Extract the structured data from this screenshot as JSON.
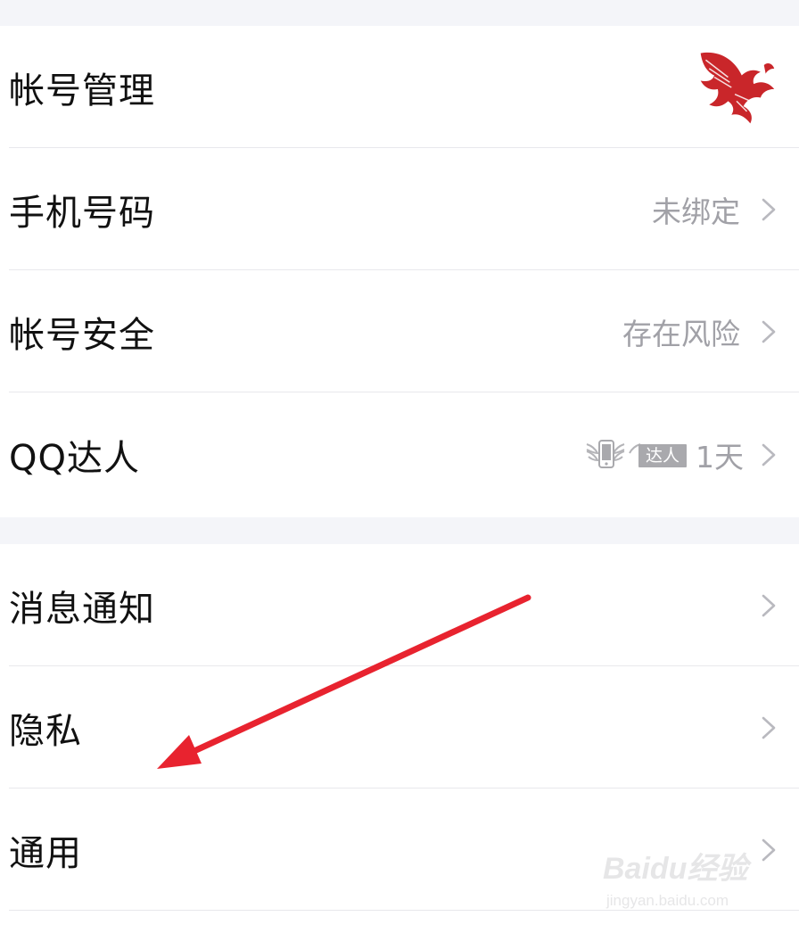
{
  "group1": [
    {
      "label": "帐号管理",
      "value": "",
      "trailing": "avatar"
    },
    {
      "label": "手机号码",
      "value": "未绑定",
      "trailing": "chevron"
    },
    {
      "label": "帐号安全",
      "value": "存在风险",
      "trailing": "chevron"
    },
    {
      "label": "QQ达人",
      "value": "1天",
      "trailing": "badge",
      "badge_text": "达人"
    }
  ],
  "group2": [
    {
      "label": "消息通知",
      "trailing": "chevron"
    },
    {
      "label": "隐私",
      "trailing": "chevron"
    },
    {
      "label": "通用",
      "trailing": "chevron"
    }
  ],
  "avatar_icon": "eagle-avatar-icon",
  "colors": {
    "background": "#f4f5f9",
    "row": "#ffffff",
    "text": "#111111",
    "secondary": "#a1a1a7",
    "annotation_arrow": "#e8232f",
    "avatar_red": "#c9262a"
  },
  "watermark": {
    "main": "Baidu经验",
    "sub": "jingyan.baidu.com"
  }
}
